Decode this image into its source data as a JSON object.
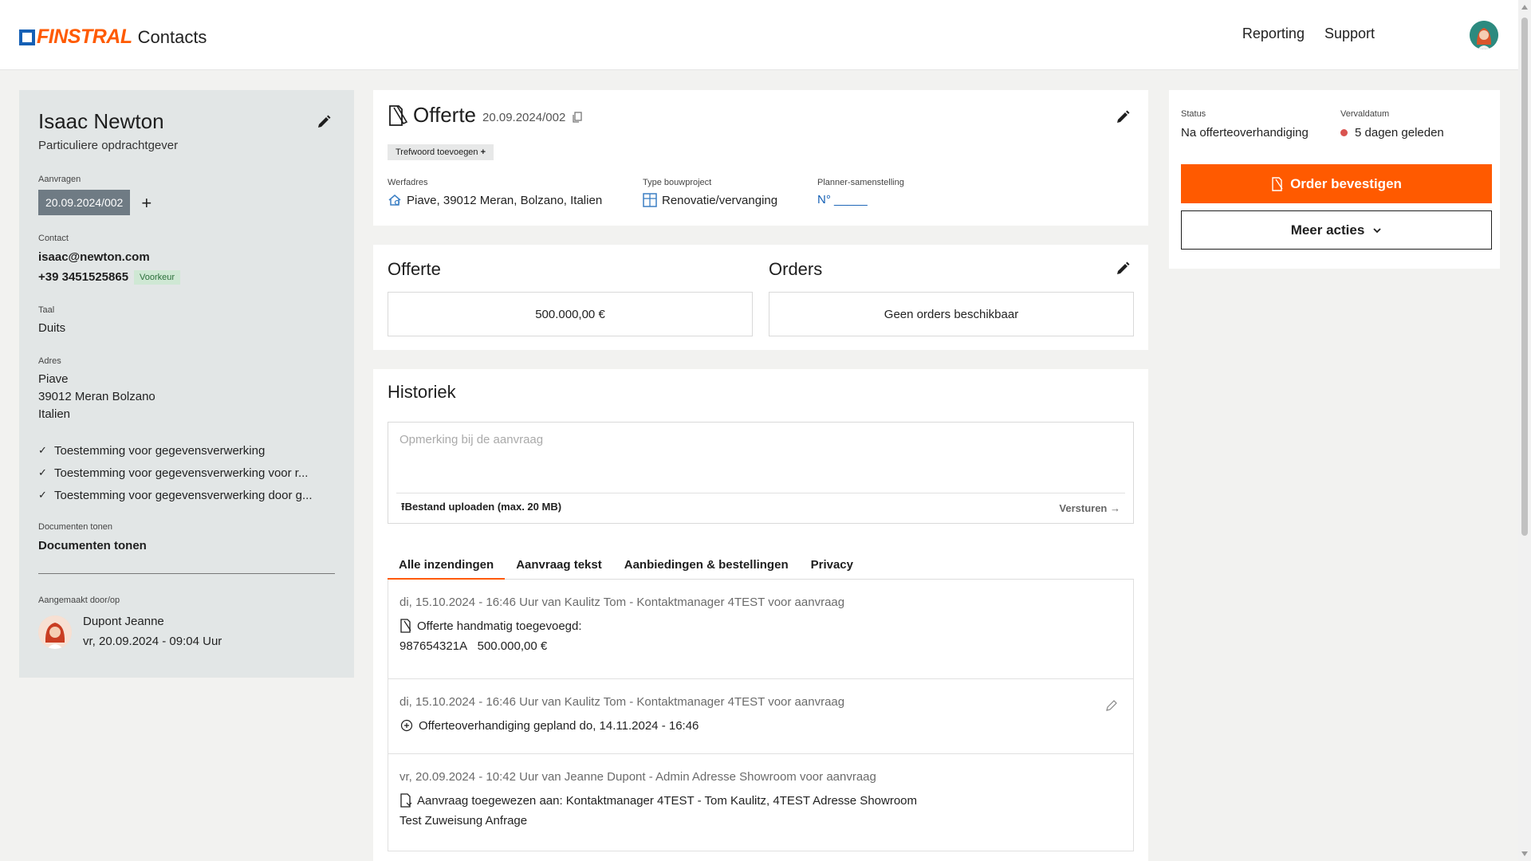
{
  "header": {
    "brand": "FINSTRAL",
    "app_name": "Contacts",
    "nav": [
      "Reporting",
      "Support"
    ]
  },
  "customer": {
    "name": "Isaac Newton",
    "type": "Particuliere opdrachtgever",
    "requests_label": "Aanvragen",
    "request_id": "20.09.2024/002",
    "contact_label": "Contact",
    "email": "isaac@newton.com",
    "phone": "+39 3451525865",
    "phone_badge": "Voorkeur",
    "language_label": "Taal",
    "language": "Duits",
    "address_label": "Adres",
    "address": [
      "Piave",
      "39012 Meran Bolzano",
      "Italien"
    ],
    "consents": [
      "Toestemming voor gegevensverwerking",
      "Toestemming voor gegevensverwerking voor r...",
      "Toestemming voor gegevensverwerking door g..."
    ],
    "documents_label": "Documenten tonen",
    "documents_link": "Documenten tonen",
    "created_label": "Aangemaakt door/op",
    "created_by": "Dupont Jeanne",
    "created_at": "vr, 20.09.2024 - 09:04 Uur"
  },
  "offer": {
    "title": "Offerte",
    "number": "20.09.2024/002",
    "tag_button": "Trefwoord toevoegen",
    "site_label": "Werfadres",
    "site": "Piave, 39012 Meran, Bolzano, Italien",
    "project_label": "Type bouwproject",
    "project": "Renovatie/vervanging",
    "planner_label": "Planner-samenstelling",
    "planner": "N° _____"
  },
  "summary": {
    "offer_title": "Offerte",
    "offer_value": "500.000,00 €",
    "orders_title": "Orders",
    "orders_value": "Geen orders beschikbaar"
  },
  "history": {
    "title": "Historiek",
    "note_placeholder": "Opmerking bij de aanvraag",
    "upload": "Bestand uploaden (max. 20 MB)",
    "send": "Versturen",
    "tabs": [
      "Alle inzendingen",
      "Aanvraag tekst",
      "Aanbiedingen & bestellingen",
      "Privacy"
    ],
    "entries": [
      {
        "meta": "di, 15.10.2024 - 16:46 Uur van Kaulitz Tom - Kontaktmanager 4TEST voor aanvraag",
        "line": "Offerte handmatig toegevoegd:",
        "sub_code": "987654321A",
        "sub_amount": "500.000,00 €"
      },
      {
        "meta": "di, 15.10.2024 - 16:46 Uur van Kaulitz Tom - Kontaktmanager 4TEST voor aanvraag",
        "line": "Offerteoverhandiging gepland do, 14.11.2024 - 16:46"
      },
      {
        "meta": "vr, 20.09.2024 - 10:42 Uur van Jeanne Dupont - Admin Adresse Showroom voor aanvraag",
        "line": "Aanvraag toegewezen aan: Kontaktmanager 4TEST - Tom Kaulitz, 4TEST Adresse Showroom",
        "sub": "Test Zuweisung Anfrage"
      }
    ]
  },
  "status_panel": {
    "status_label": "Status",
    "status": "Na offerteoverhandiging",
    "due_label": "Vervaldatum",
    "due": "5 dagen geleden",
    "primary_button": "Order bevestigen",
    "secondary_button": "Meer acties"
  },
  "colors": {
    "accent": "#ff5a00",
    "brand_blue": "#1560b5",
    "panel": "#e2e6e6",
    "overdue_dot": "#d9534f"
  }
}
